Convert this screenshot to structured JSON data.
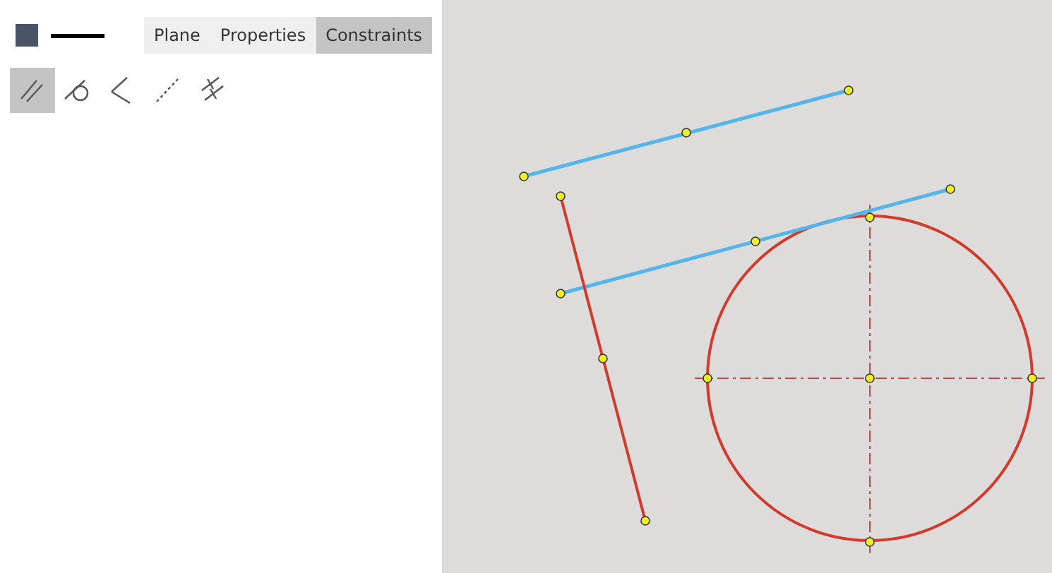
{
  "tabs": [
    {
      "label": "Plane",
      "selected": false
    },
    {
      "label": "Properties",
      "selected": false
    },
    {
      "label": "Constraints",
      "selected": true
    }
  ],
  "tools": [
    {
      "kind": "parallel",
      "selected": true
    },
    {
      "kind": "tangent",
      "selected": false
    },
    {
      "kind": "perpendicular",
      "selected": false
    },
    {
      "kind": "collinear",
      "selected": false
    },
    {
      "kind": "equal",
      "selected": false
    }
  ]
}
